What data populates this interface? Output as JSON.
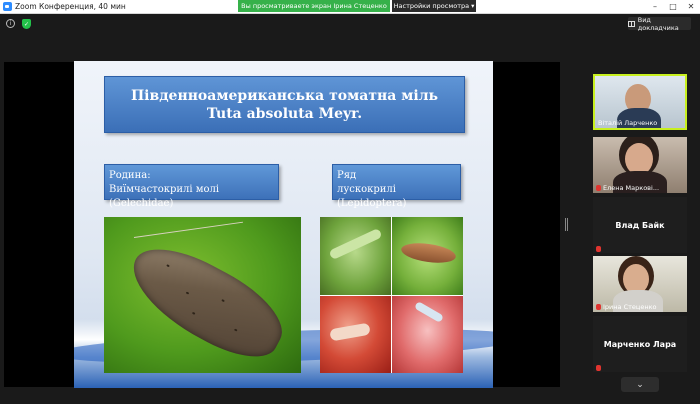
{
  "window": {
    "title": "Zoom Конференция, 40 мин",
    "controls": [
      "–",
      "□",
      "✕"
    ]
  },
  "share_banner": "Вы просматриваете экран Ірина Стеценко",
  "view_options": {
    "label": "Настройки просмотра",
    "chevron": "▾"
  },
  "toolbar": {
    "info": "i",
    "view_button": "Вид докладчика"
  },
  "slide": {
    "title_line1": "Південноамериканська томатна міль",
    "title_line2": "Tuta absoluta Meyr.",
    "family_line1": "Родина:",
    "family_line2": "Виїмчастокрилі молі (Gelechidae)",
    "order_line1": "Ряд",
    "order_line2": "лускокрилі (Lepidoptera)"
  },
  "participants": [
    {
      "name": "Віталій Ларченко",
      "video": true,
      "active": true,
      "mic_muted": false
    },
    {
      "name": "Елена Маркові...",
      "video": true,
      "active": false,
      "mic_muted": true
    },
    {
      "name": "Влад Байк",
      "video": false,
      "active": false,
      "mic_muted": true
    },
    {
      "name": "Ірина Стеценко",
      "video": true,
      "active": false,
      "mic_muted": true
    },
    {
      "name": "Марченко Лара",
      "video": false,
      "active": false,
      "mic_muted": true
    }
  ],
  "gallery": {
    "scroll_down": "⌄"
  },
  "colors": {
    "accent_green": "#36b14a",
    "active_speaker": "#c8f01f",
    "slide_box": "#3d71b9"
  }
}
